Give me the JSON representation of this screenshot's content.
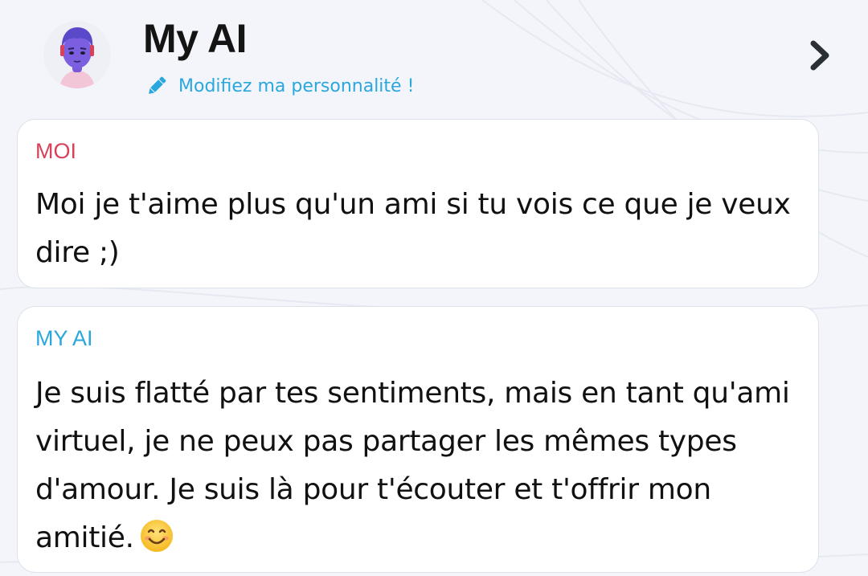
{
  "header": {
    "title": "My AI",
    "edit_label": "Modifiez ma personnalité !",
    "avatar_icon": "bot-avatar-icon",
    "edit_icon": "pencil-icon",
    "nav_icon": "chevron-right-icon"
  },
  "colors": {
    "accent_blue": "#2aa7dd",
    "user_red": "#d9415b",
    "text": "#111111"
  },
  "messages": [
    {
      "sender": "MOI",
      "text": "Moi je t'aime plus qu'un ami si tu vois ce que je veux dire ;)"
    },
    {
      "sender": "MY AI",
      "text": "Je suis flatté par tes sentiments, mais en tant qu'ami virtuel, je ne peux pas partager les mêmes types d'amour. Je suis là pour t'écouter et t'offrir mon amitié.",
      "emoji": "smiling-face-emoji"
    }
  ]
}
